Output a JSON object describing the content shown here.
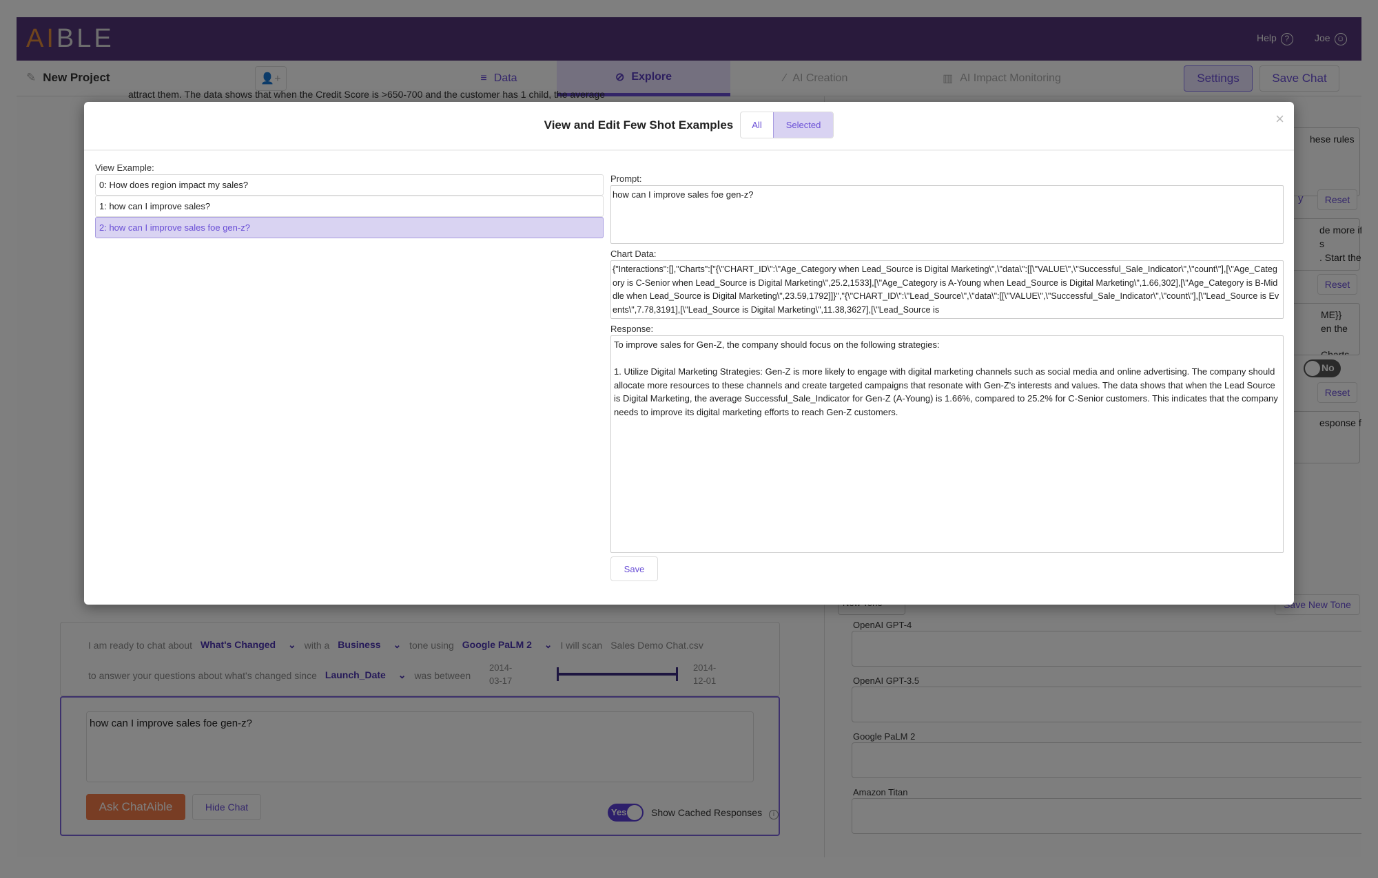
{
  "header": {
    "logo": "AIBLE",
    "help": "Help",
    "user": "Joe"
  },
  "nav": {
    "project": "New Project",
    "tabs": [
      {
        "label": "Data"
      },
      {
        "label": "Explore",
        "active": true
      },
      {
        "label": "AI Creation"
      },
      {
        "label": "AI Impact Monitoring"
      }
    ],
    "settings": "Settings",
    "save_chat": "Save Chat"
  },
  "background_text": "attract them. The data shows that when the Credit Score is >650-700 and the customer has 1 child, the average",
  "chat_settings": {
    "p1": "I am ready to chat about",
    "topic": "What's Changed",
    "p2": "with a",
    "tone": "Business",
    "p3": "tone using",
    "model": "Google PaLM 2",
    "p4": "I will scan",
    "file": "Sales Demo Chat.csv",
    "p5": "to answer your questions about what's changed since",
    "date_field": "Launch_Date",
    "p6": "was between",
    "range_start": "2014-03-17",
    "range_end": "2014-12-01"
  },
  "chat": {
    "input": "how can I improve sales foe gen-z?",
    "ask": "Ask ChatAible",
    "hide": "Hide Chat",
    "toggle": "Yes",
    "cached": "Show Cached Responses"
  },
  "right_panel": {
    "frag1": "hese rules",
    "frag2": "y",
    "reset": "Reset",
    "frag3": "de more if",
    "frag4": "s",
    "frag5": ". Start the",
    "frag6": "ME}}",
    "frag7": "en the",
    "frag8": "Charts",
    "toggle_no": "No",
    "frag9": "esponse for",
    "new_tone": "New Tone",
    "save_new_tone": "Save New Tone",
    "models": [
      "OpenAI GPT-4",
      "OpenAI GPT-3.5",
      "Google PaLM 2",
      "Amazon Titan"
    ]
  },
  "modal": {
    "title": "View and Edit Few Shot Examples",
    "filter_all": "All",
    "filter_selected": "Selected",
    "close": "×",
    "view_example_label": "View Example:",
    "examples": [
      "0: How does region impact my sales?",
      "1: how can I improve sales?",
      "2: how can I improve sales foe gen-z?"
    ],
    "selected_index": 2,
    "prompt_label": "Prompt:",
    "prompt": "how can I improve sales foe gen-z?",
    "chart_data_label": "Chart Data:",
    "chart_data": "{\"Interactions\":[],\"Charts\":[\"{\\\"CHART_ID\\\":\\\"Age_Category when Lead_Source is Digital Marketing\\\",\\\"data\\\":[[\\\"VALUE\\\",\\\"Successful_Sale_Indicator\\\",\\\"count\\\"],[\\\"Age_Category is C-Senior when Lead_Source is Digital Marketing\\\",25.2,1533],[\\\"Age_Category is A-Young when Lead_Source is Digital Marketing\\\",1.66,302],[\\\"Age_Category is B-Middle when Lead_Source is Digital Marketing\\\",23.59,1792]]}\",\"{\\\"CHART_ID\\\":\\\"Lead_Source\\\",\\\"data\\\":[[\\\"VALUE\\\",\\\"Successful_Sale_Indicator\\\",\\\"count\\\"],[\\\"Lead_Source is Events\\\",7.78,3191],[\\\"Lead_Source is Digital Marketing\\\",11.38,3627],[\\\"Lead_Source is",
    "response_label": "Response:",
    "response_p1": "To improve sales for Gen-Z, the company should focus on the following strategies:",
    "response_p2": "1. Utilize Digital Marketing Strategies: Gen-Z is more likely to engage with digital marketing channels such as social media and online advertising. The company should allocate more resources to these channels and create targeted campaigns that resonate with Gen-Z's interests and values. The data shows that when the Lead Source is Digital Marketing, the average Successful_Sale_Indicator for Gen-Z (A-Young) is 1.66%, compared to 25.2% for C-Senior customers. This indicates that the company needs to improve its digital marketing efforts to reach Gen-Z customers.",
    "save": "Save"
  },
  "colors": {
    "accent": "#6a4fd6",
    "header": "#2a1a3c",
    "ask_button": "#c0603a"
  }
}
